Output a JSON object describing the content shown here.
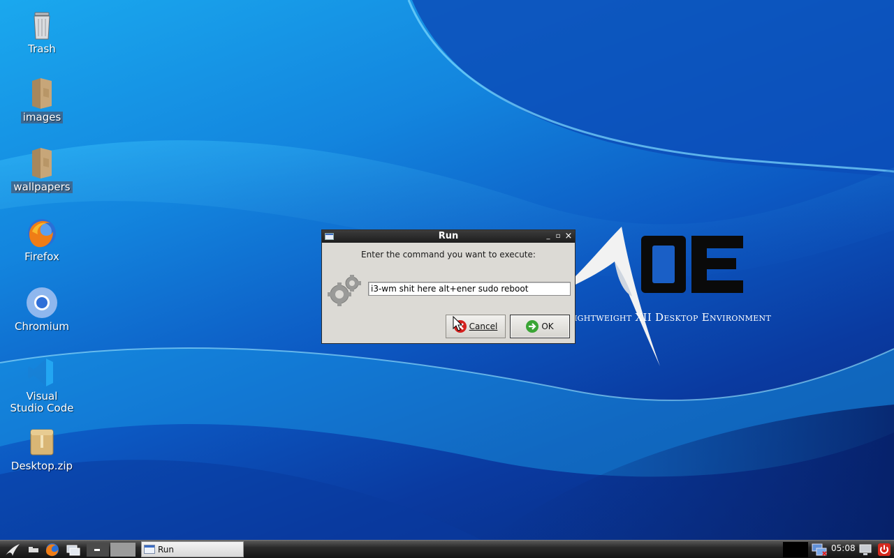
{
  "desktop": {
    "icons": [
      {
        "label": "Trash"
      },
      {
        "label": "images"
      },
      {
        "label": "wallpapers"
      },
      {
        "label": "Firefox"
      },
      {
        "label": "Chromium"
      },
      {
        "label": "Visual Studio Code"
      },
      {
        "label": "Desktop.zip"
      }
    ],
    "wallpaper_text": "Lightweight X11 Desktop Environment",
    "wallpaper_visible_text": "ightweight XII Desktop Environment"
  },
  "dialog": {
    "title": "Run",
    "prompt": "Enter the command you want to execute:",
    "command_value": "i3-wm shit here alt+ener sudo reboot",
    "cancel_label": "Cancel",
    "ok_label": "OK",
    "minimize_glyph": "_",
    "maximize_glyph": "▫",
    "close_glyph": "×"
  },
  "taskbar": {
    "task_label": "Run",
    "clock": "05:08"
  },
  "colors": {
    "titlebar": "#1d1d1d",
    "dialog_bg": "#dcdad5",
    "cancel_icon": "#d4211f",
    "ok_icon": "#3aa535"
  }
}
